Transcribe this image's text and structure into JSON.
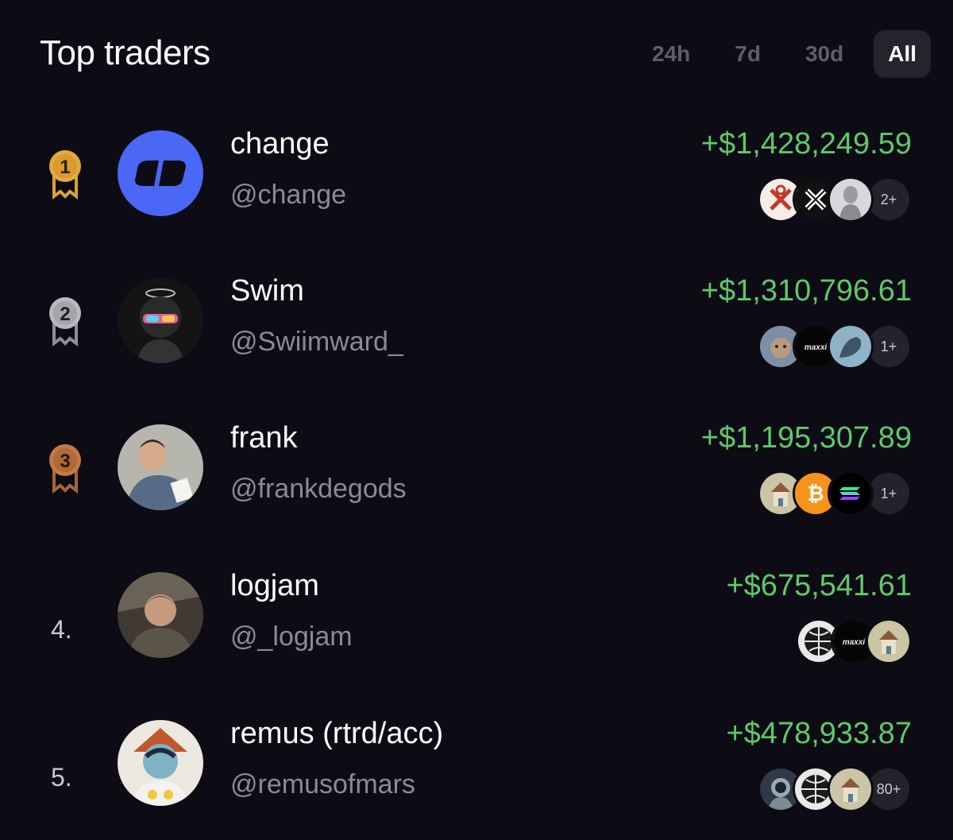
{
  "header": {
    "title": "Top traders",
    "tabs": [
      {
        "label": "24h",
        "active": false
      },
      {
        "label": "7d",
        "active": false
      },
      {
        "label": "30d",
        "active": false
      },
      {
        "label": "All",
        "active": true
      }
    ]
  },
  "traders": [
    {
      "rank": "1",
      "name": "change",
      "handle": "@change",
      "pnl": "+$1,428,249.59",
      "more": "2+"
    },
    {
      "rank": "2",
      "name": "Swim",
      "handle": "@Swiimward_",
      "pnl": "+$1,310,796.61",
      "more": "1+"
    },
    {
      "rank": "3",
      "name": "frank",
      "handle": "@frankdegods",
      "pnl": "+$1,195,307.89",
      "more": "1+"
    },
    {
      "rank": "4.",
      "name": "logjam",
      "handle": "@_logjam",
      "pnl": "+$675,541.61",
      "more": ""
    },
    {
      "rank": "5.",
      "name": "remus (rtrd/acc)",
      "handle": "@remusofmars",
      "pnl": "+$478,933.87",
      "more": "80+"
    }
  ],
  "token_labels": {
    "maxxing": "maxxi"
  },
  "colors": {
    "background": "#0d0c14",
    "profit": "#5ec96a",
    "gold": "#d9a13b",
    "silver": "#9a9aa0",
    "bronze": "#b5703e"
  }
}
